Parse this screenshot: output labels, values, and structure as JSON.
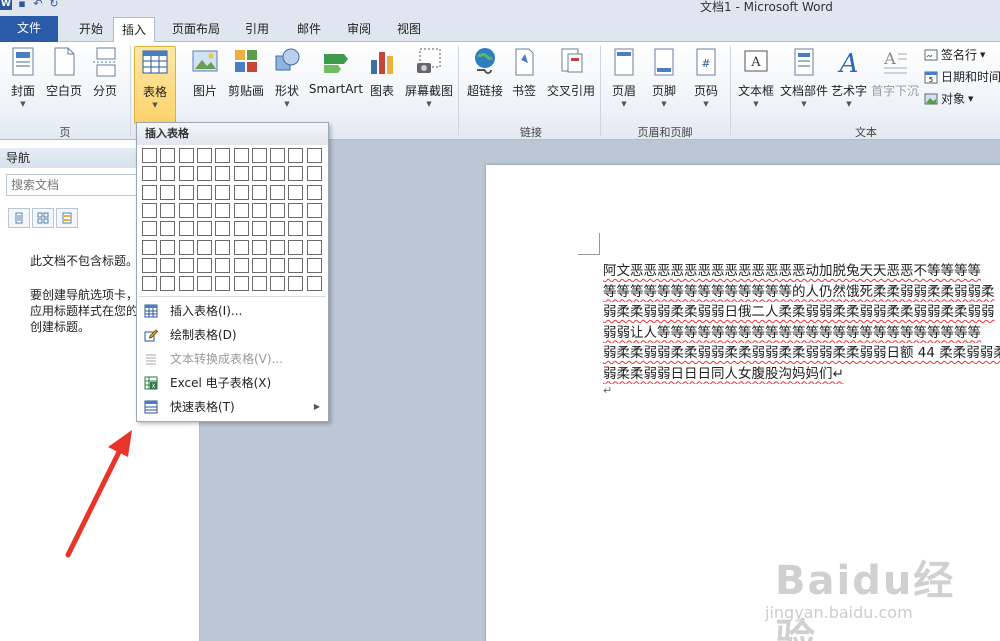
{
  "window": {
    "title": "文档1 - Microsoft Word"
  },
  "tabs": [
    {
      "label": "文件"
    },
    {
      "label": "开始"
    },
    {
      "label": "插入"
    },
    {
      "label": "页面布局"
    },
    {
      "label": "引用"
    },
    {
      "label": "邮件"
    },
    {
      "label": "审阅"
    },
    {
      "label": "视图"
    }
  ],
  "ribbon": {
    "pages": {
      "cover": "封面",
      "blank": "空白页",
      "break": "分页",
      "group": "页"
    },
    "table": {
      "label": "表格"
    },
    "illus": {
      "picture": "图片",
      "clipart": "剪贴画",
      "shapes": "形状",
      "smartart": "SmartArt",
      "chart": "图表",
      "screenshot": "屏幕截图"
    },
    "links": {
      "hyperlink": "超链接",
      "bookmark": "书签",
      "crossref": "交叉引用",
      "group": "链接"
    },
    "hf": {
      "header": "页眉",
      "footer": "页脚",
      "pagenum": "页码",
      "group": "页眉和页脚"
    },
    "text": {
      "textbox": "文本框",
      "quickparts": "文档部件",
      "wordart": "艺术字",
      "dropcap": "首字下沉",
      "signature": "签名行",
      "datetime": "日期和时间",
      "object": "对象",
      "group": "文本"
    }
  },
  "dropdown": {
    "title": "插入表格",
    "items": [
      {
        "label": "插入表格(I)..."
      },
      {
        "label": "绘制表格(D)"
      },
      {
        "label": "文本转换成表格(V)..."
      },
      {
        "label": "Excel 电子表格(X)"
      },
      {
        "label": "快速表格(T)"
      }
    ]
  },
  "nav": {
    "title": "导航",
    "search_placeholder": "搜索文档",
    "msg1": "此文档不包含标题。",
    "msg2_lines": [
      "要创建导航选项卡，",
      "应用标题样式在您的",
      "创建标题。"
    ]
  },
  "document": {
    "lines": [
      "阿文恶恶恶恶恶恶恶恶恶恶恶恶恶动加脱兔天天恶恶不等等等等",
      "等等等等等等等等等等等等等等的人仍然饿死柔柔弱弱柔柔弱弱柔",
      "弱柔柔弱弱柔柔弱弱日俄二人柔柔弱弱柔柔弱弱柔柔弱弱柔柔弱弱",
      "弱弱让人等等等等等等等等等等等等等等等等等等等等等等等等",
      "弱柔柔弱弱柔柔弱弱柔柔弱弱柔柔弱弱柔柔弱弱日额 44 柔柔弱弱柔",
      "弱柔柔弱弱日日日同人女腹股沟妈妈们↵"
    ],
    "pilcrow": "↵"
  },
  "watermark": {
    "logo": "Baidu经验",
    "url": "jingyan.baidu.com"
  },
  "colors": {
    "file_tab": "#2a5ba8",
    "active_button": "#fbd36a",
    "arrow": "#e8342a"
  }
}
